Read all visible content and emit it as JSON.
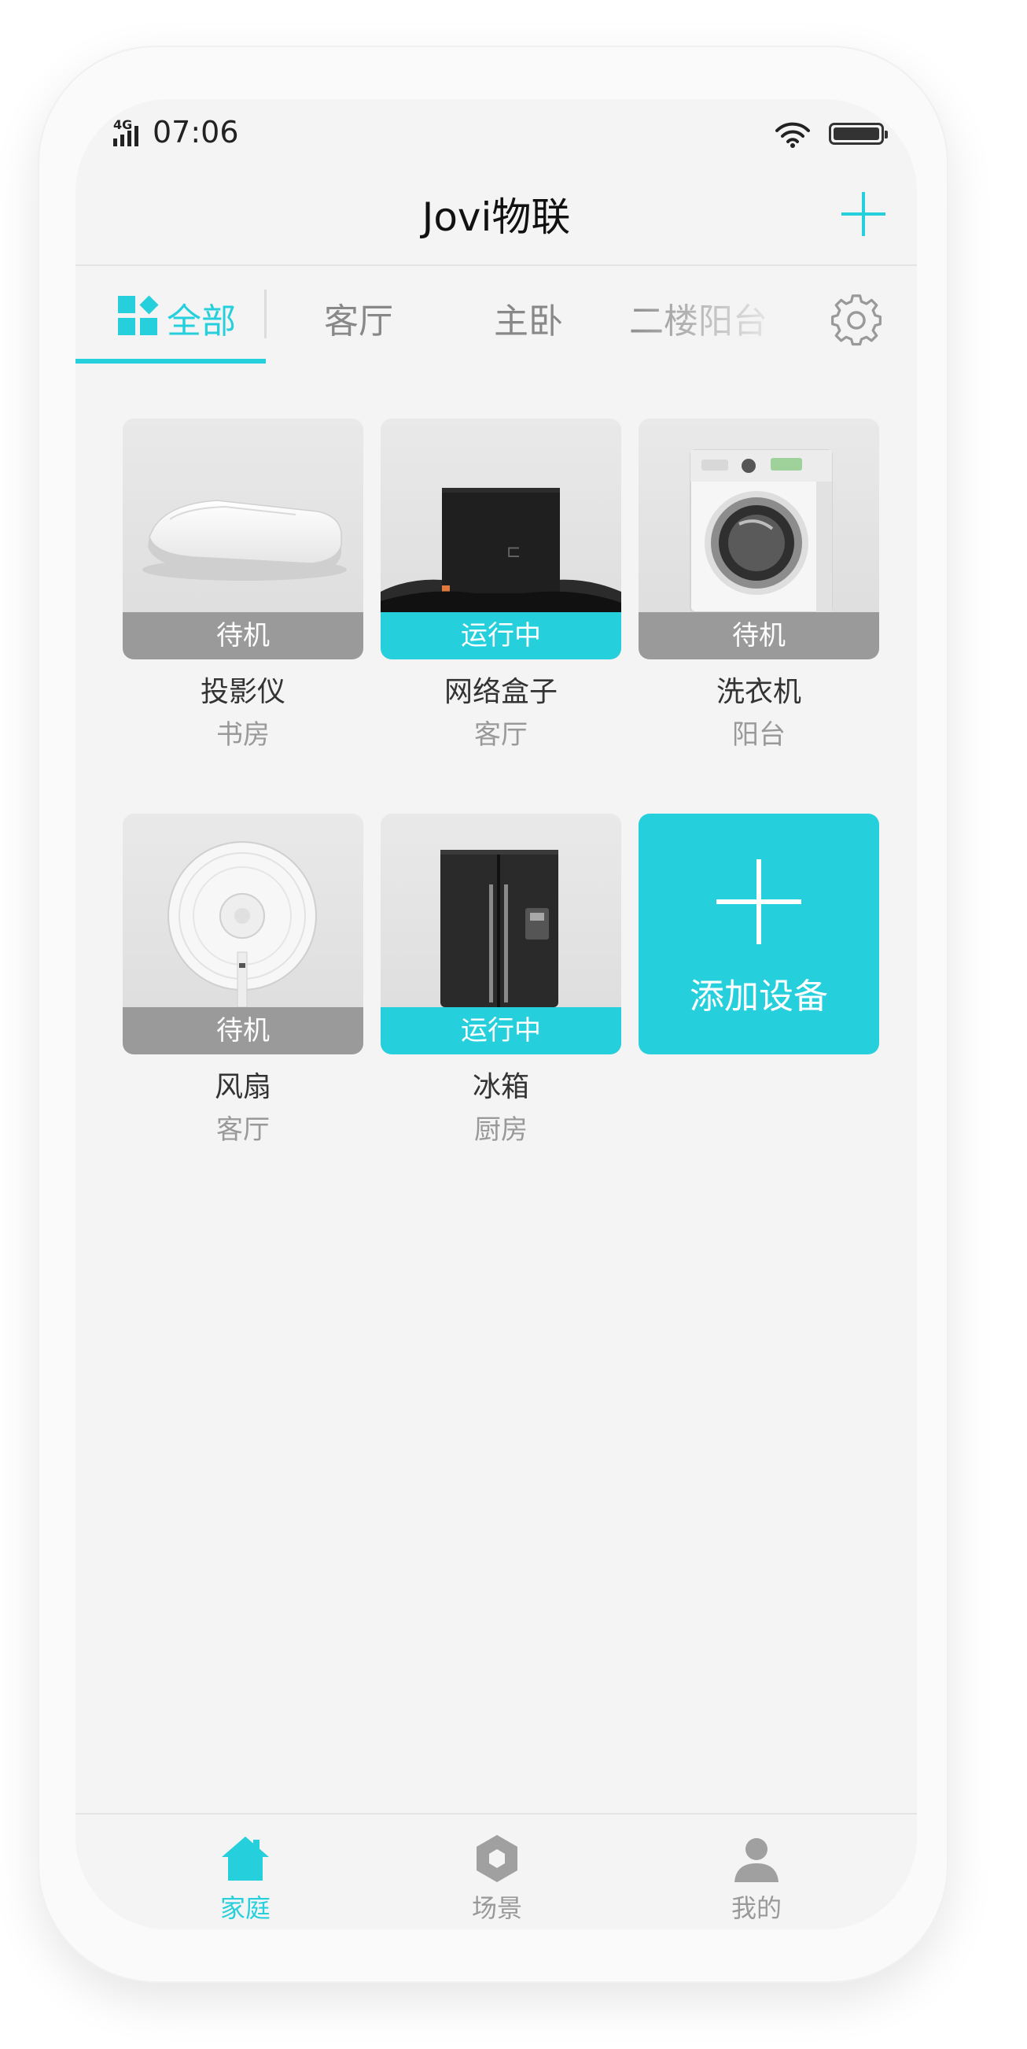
{
  "status_bar": {
    "network": "4G",
    "time": "07:06"
  },
  "header": {
    "title": "Jovi物联"
  },
  "tabs": [
    {
      "label": "全部",
      "active": true
    },
    {
      "label": "客厅",
      "active": false
    },
    {
      "label": "主卧",
      "active": false
    },
    {
      "label": "二楼阳台",
      "active": false
    }
  ],
  "devices": [
    {
      "name": "投影仪",
      "room": "书房",
      "status": "待机",
      "icon": "projector-image"
    },
    {
      "name": "网络盒子",
      "room": "客厅",
      "status": "运行中",
      "icon": "network-box-image"
    },
    {
      "name": "洗衣机",
      "room": "阳台",
      "status": "待机",
      "icon": "washing-machine-image"
    },
    {
      "name": "风扇",
      "room": "客厅",
      "status": "待机",
      "icon": "fan-image"
    },
    {
      "name": "冰箱",
      "room": "厨房",
      "status": "运行中",
      "icon": "fridge-image"
    }
  ],
  "add_device": {
    "label": "添加设备"
  },
  "bottom_nav": [
    {
      "label": "家庭",
      "icon": "home-icon",
      "active": true
    },
    {
      "label": "场景",
      "icon": "scene-hexagon-icon",
      "active": false
    },
    {
      "label": "我的",
      "icon": "profile-icon",
      "active": false
    }
  ],
  "colors": {
    "accent": "#25d0dc",
    "idle": "#9a9a9a",
    "background": "#f4f4f4"
  },
  "battery_level": 1.0
}
